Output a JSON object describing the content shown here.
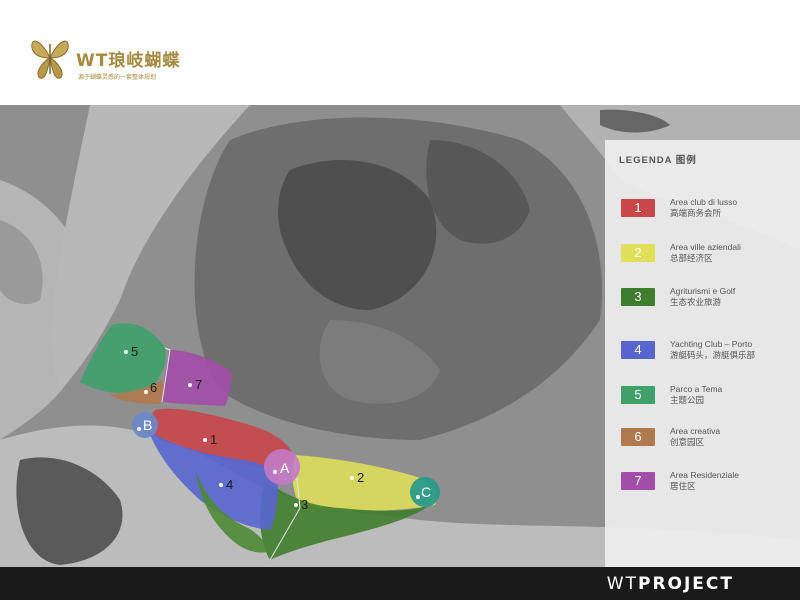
{
  "logo": {
    "brand": "WT琅岐蝴蝶",
    "tagline": "源于蝴蝶灵感的一套整体规划"
  },
  "legend": {
    "title": "LEGENDA  图例",
    "items": [
      {
        "num": "1",
        "it": "Area club di lusso",
        "zh": "高端商务会所",
        "color": "#c9464a"
      },
      {
        "num": "2",
        "it": "Area ville aziendali",
        "zh": "总部经济区",
        "color": "#dfe05a"
      },
      {
        "num": "3",
        "it": "Agriturismi e Golf",
        "zh": "生态农业旅游",
        "color": "#3f7d2e"
      },
      {
        "num": "4",
        "it": "Yachting Club – Porto",
        "zh": "游艇码头，游艇俱乐部",
        "color": "#5865cf"
      },
      {
        "num": "5",
        "it": "Parco a Tema",
        "zh": "主题公园",
        "color": "#3fa06a"
      },
      {
        "num": "6",
        "it": "Area creativa",
        "zh": "创意园区",
        "color": "#b07a4e"
      },
      {
        "num": "7",
        "it": "Area Residenziale",
        "zh": "居住区",
        "color": "#a24ea8"
      }
    ]
  },
  "map": {
    "zone_labels": [
      "1",
      "2",
      "3",
      "4",
      "5",
      "6",
      "7"
    ],
    "markers": [
      {
        "label": "A",
        "color": "#c47bc6"
      },
      {
        "label": "B",
        "color": "#6d88c9"
      },
      {
        "label": "C",
        "color": "#2a9a8c"
      }
    ]
  },
  "footer": {
    "brand_wt": "WT",
    "brand_rest": "PROJECT"
  }
}
